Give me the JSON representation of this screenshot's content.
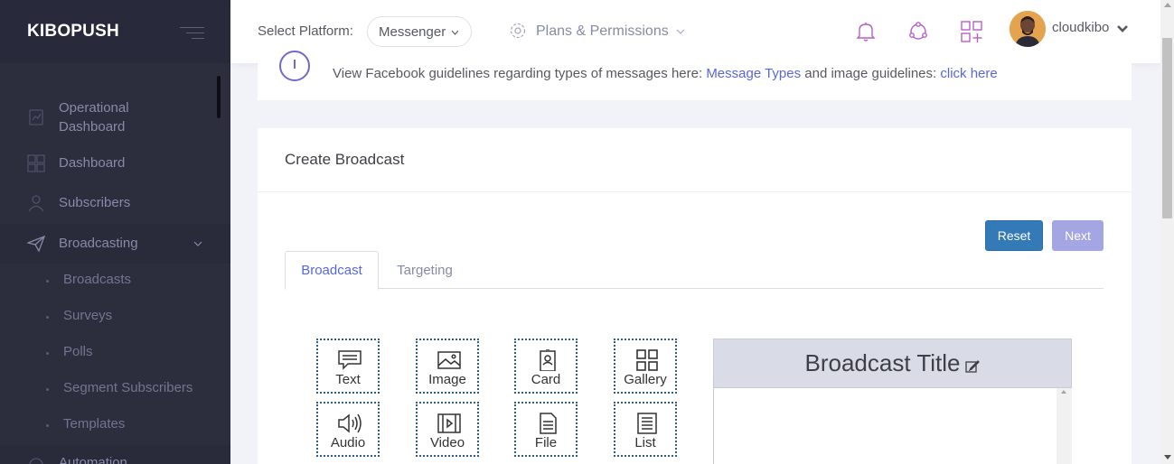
{
  "brand": {
    "name": "KIBOPUSH"
  },
  "sidebar": {
    "items": [
      {
        "label1": "Operational",
        "label2": "Dashboard",
        "icon": "dashboard-chart-icon"
      },
      {
        "label": "Dashboard",
        "icon": "grid-icon"
      },
      {
        "label": "Subscribers",
        "icon": "user-icon"
      },
      {
        "label": "Broadcasting",
        "icon": "paper-plane-icon"
      },
      {
        "label": "Automation",
        "icon": "automation-icon"
      }
    ],
    "subitems": [
      "Broadcasts",
      "Surveys",
      "Polls",
      "Segment Subscribers",
      "Templates"
    ]
  },
  "header": {
    "select_label": "Select Platform:",
    "platform": "Messenger",
    "plans": "Plans & Permissions",
    "username": "cloudkibo"
  },
  "info": {
    "text1": "View Facebook guidelines regarding types of messages here: ",
    "link1": "Message Types",
    "text2": " and image guidelines: ",
    "link2": "click here"
  },
  "card": {
    "title": "Create Broadcast",
    "reset": "Reset",
    "next": "Next",
    "tabs": [
      "Broadcast",
      "Targeting"
    ],
    "components": [
      "Text",
      "Image",
      "Card",
      "Gallery",
      "Audio",
      "Video",
      "File",
      "List"
    ],
    "preview_title": "Broadcast Title"
  },
  "colors": {
    "accent": "#5867dd",
    "sidebar": "#2c2e3e",
    "reset": "#337ab7",
    "next": "#a4a6e3"
  }
}
